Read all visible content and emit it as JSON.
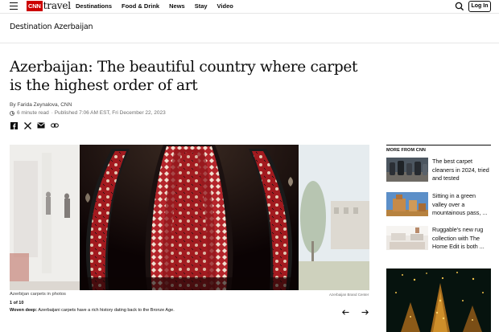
{
  "header": {
    "logo_brand": "CNN",
    "logo_section": "travel",
    "nav": [
      "Destinations",
      "Food & Drink",
      "News",
      "Stay",
      "Video"
    ],
    "login_label": "Log In"
  },
  "section": {
    "title": "Destination Azerbaijan"
  },
  "article": {
    "headline": "Azerbaijan: The beautiful country where carpet is the highest order of art",
    "byline": "By Farida Zeynalova, CNN",
    "read_time": "6 minute read",
    "published": "· Published 7:06 AM EST, Fri December 22, 2023"
  },
  "gallery": {
    "caption_title": "Azerbijan carpets in photos",
    "credit": "Azerbaijan Brand Center",
    "counter": "1 of 10",
    "desc_bold": "Woven deep:",
    "desc_text": " Azerbaijani carpets have a rich history dating back to the Bronze Age."
  },
  "rail": {
    "heading": "MORE FROM CNN",
    "items": [
      {
        "text": "The best carpet cleaners in 2024, tried and tested"
      },
      {
        "text": "Sitting in a green valley over a mountainous pass, ..."
      },
      {
        "text": "Ruggable's new rug collection with The Home Edit is both ..."
      }
    ]
  },
  "colors": {
    "brand": "#cc0000",
    "text": "#0c0c0c",
    "muted": "#6e6e6e"
  },
  "icons": [
    "hamburger-icon",
    "search-icon",
    "facebook-icon",
    "x-icon",
    "email-icon",
    "link-icon",
    "arrow-left-icon",
    "arrow-right-icon",
    "clock-icon"
  ]
}
